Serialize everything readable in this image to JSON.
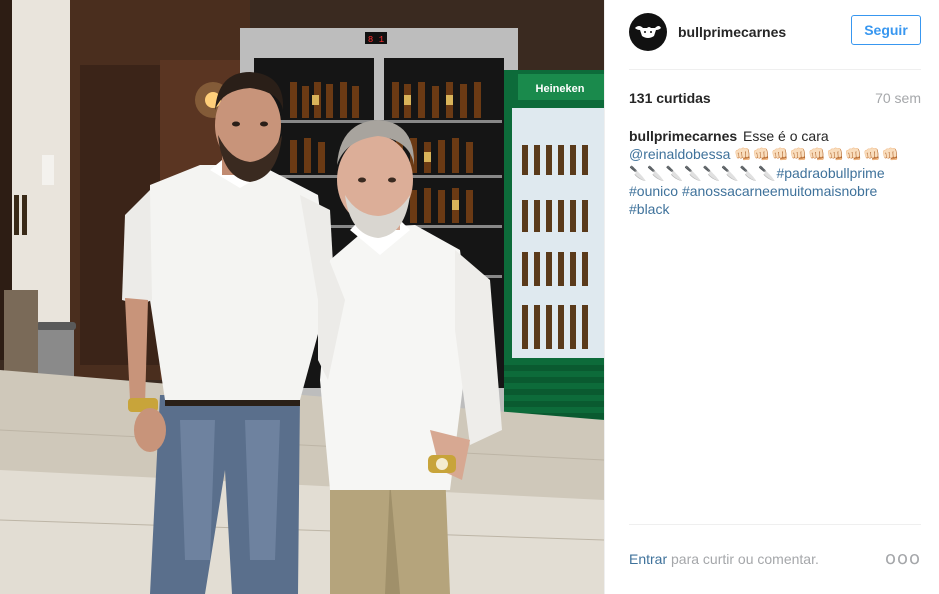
{
  "post": {
    "username": "bullprimecarnes",
    "follow_label": "Seguir",
    "likes": "131 curtidas",
    "age": "70 sem",
    "caption": {
      "username": "bullprimecarnes",
      "text": "Esse é o cara",
      "mention": "@reinaldobessa",
      "fist_emojis": "👊🏻👊🏻👊🏻👊🏻👊🏻👊🏻👊🏻👊🏻👊🏻",
      "knife_emojis": "🔪🔪🔪🔪🔪🔪🔪🔪",
      "hashtags": [
        "#padraobullprime",
        "#ounico",
        "#anossacarneemuitomaisnobre",
        "#black"
      ]
    },
    "footer": {
      "login_link": "Entrar",
      "login_text": " para curtir ou comentar.",
      "more_label": "ooo"
    }
  },
  "photo": {
    "fridge_display": "8 1",
    "fridge_brand": "Heineken"
  }
}
